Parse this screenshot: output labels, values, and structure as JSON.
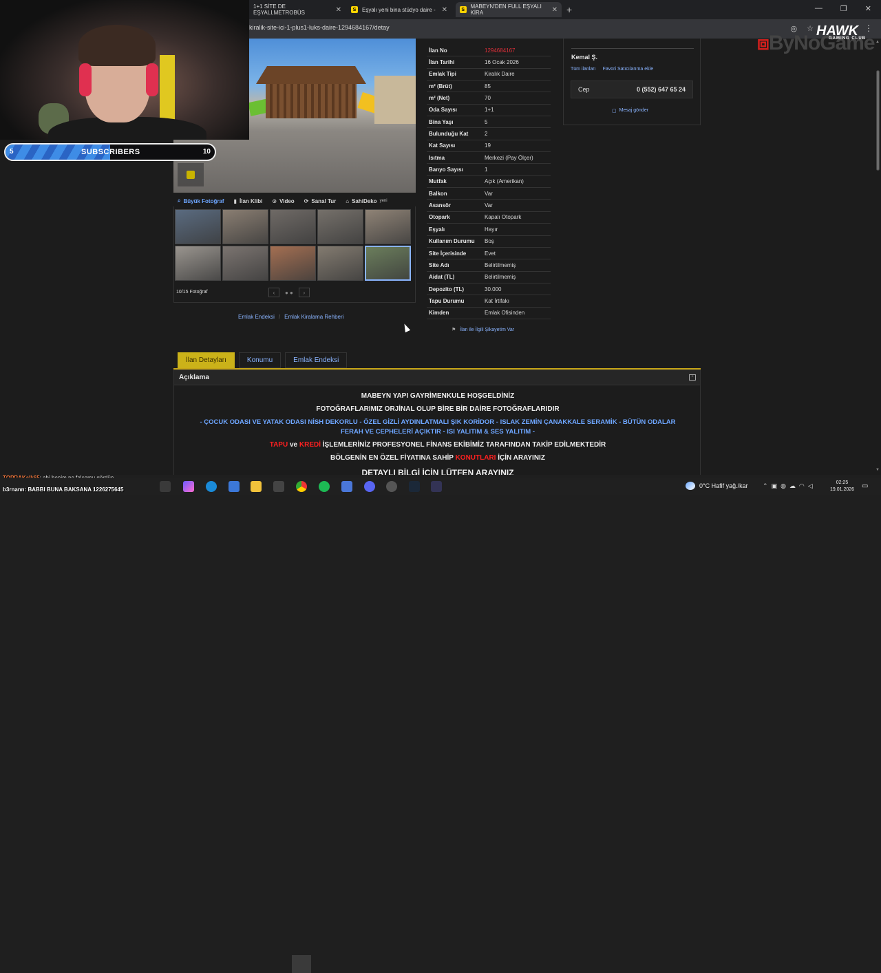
{
  "browser": {
    "tabs": [
      {
        "title": "1+1 SİTE DE EŞYALI,METROBÜS",
        "favicon": "S",
        "active": false
      },
      {
        "title": "Eşyalı yeni bina stüdyo daire - ",
        "favicon": "S",
        "active": false
      },
      {
        "title": "MABEYN'DEN FULL EŞYALI KİRA",
        "favicon": "S",
        "active": true
      }
    ],
    "url": "ali-kiralik-site-ici-1-plus1-luks-daire-1294684167/detay"
  },
  "gallery": {
    "media_tabs": [
      {
        "label": "Büyük Fotoğraf",
        "icon": "magnifier-icon"
      },
      {
        "label": "İlan Klibi",
        "icon": "camera-icon"
      },
      {
        "label": "Video",
        "icon": "play-icon"
      },
      {
        "label": "Sanal Tur",
        "icon": "360-icon"
      },
      {
        "label": "SahiDeko",
        "icon": "home-icon",
        "badge": "yeni"
      }
    ],
    "thumbnail_count_shown": 10,
    "counter": "10/15 Fotoğraf",
    "thumb_colors": [
      "#5a6b80",
      "#8a7e72",
      "#6f6a66",
      "#75706a",
      "#8f8376",
      "#9a958f",
      "#7b7470",
      "#a46f52",
      "#837b70",
      "#6b7e5c"
    ]
  },
  "bottom_links": [
    "Emlak Endeksi",
    "Emlak Kiralama Rehberi"
  ],
  "details": [
    {
      "label": "İlan No",
      "value": "1294684167",
      "highlight": true
    },
    {
      "label": "İlan Tarihi",
      "value": "16 Ocak 2026"
    },
    {
      "label": "Emlak Tipi",
      "value": "Kiralık Daire"
    },
    {
      "label": "m² (Brüt)",
      "value": "85"
    },
    {
      "label": "m² (Net)",
      "value": "70"
    },
    {
      "label": "Oda Sayısı",
      "value": "1+1"
    },
    {
      "label": "Bina Yaşı",
      "value": "5"
    },
    {
      "label": "Bulunduğu Kat",
      "value": "2"
    },
    {
      "label": "Kat Sayısı",
      "value": "19"
    },
    {
      "label": "Isıtma",
      "value": "Merkezi (Pay Ölçer)"
    },
    {
      "label": "Banyo Sayısı",
      "value": "1"
    },
    {
      "label": "Mutfak",
      "value": "Açık (Amerikan)"
    },
    {
      "label": "Balkon",
      "value": "Var"
    },
    {
      "label": "Asansör",
      "value": "Var"
    },
    {
      "label": "Otopark",
      "value": "Kapalı Otopark"
    },
    {
      "label": "Eşyalı",
      "value": "Hayır"
    },
    {
      "label": "Kullanım Durumu",
      "value": "Boş"
    },
    {
      "label": "Site İçerisinde",
      "value": "Evet"
    },
    {
      "label": "Site Adı",
      "value": "Belirtilmemiş"
    },
    {
      "label": "Aidat (TL)",
      "value": "Belirtilmemiş"
    },
    {
      "label": "Depozito (TL)",
      "value": "30.000"
    },
    {
      "label": "Tapu Durumu",
      "value": "Kat İrtifakı"
    },
    {
      "label": "Kimden",
      "value": "Emlak Ofisinden"
    }
  ],
  "report_link": "İlan ile İlgili Şikayetim Var",
  "seller": {
    "name": "Kemal Ş.",
    "links": [
      "Tüm ilanları",
      "Favori Satıcılarıma ekle"
    ],
    "phone_label": "Cep",
    "phone": "0 (552) 647 65 24",
    "message": "Mesaj gönder"
  },
  "content_tabs": [
    "İlan Detayları",
    "Konumu",
    "Emlak Endeksi"
  ],
  "description": {
    "heading": "Açıklama",
    "lines": [
      "MABEYN YAPI GAYRİMENKULE HOŞGELDİNİZ",
      "FOTOĞRAFLARIMIZ ORJİNAL OLUP BİRE BİR DAİRE FOTOĞRAFLARIDIR",
      "- ÇOCUK ODASI VE YATAK ODASI NİSH DEKORLU - ÖZEL GİZLİ AYDINLATMALI ŞIK KORİDOR - ISLAK ZEMİN ÇANAKKALE SERAMİK - BÜTÜN ODALAR",
      "FERAH VE CEPHELERİ AÇIKTIR - ISI YALITIM &  SES YALITIM -",
      "İŞLEMLERİNİZ PROFESYONEL FİNANS EKİBİMİZ TARAFINDAN TAKİP EDİLMEKTEDİR",
      "BÖLGENİN EN ÖZEL FİYATINA SAHİP",
      "İÇİN ARAYINIZ",
      "DETAYLI BİLGİ İÇİN LÜTFEN ARAYINIZ"
    ],
    "red_words": {
      "tapu": "TAPU",
      "ve": "ve",
      "kredi": "KREDİ",
      "konut": "KONUTLARI"
    }
  },
  "overlay": {
    "sub_goal_start": "5",
    "sub_label": "SUBSCRIBERS",
    "sub_goal_end": "10",
    "sub_progress": 0.5,
    "chat": [
      {
        "user": "TOPRAKalk65",
        "message": ": abi benim ne falsomu gördün"
      },
      {
        "user": "b3rnann",
        "message": ": BABBI BUNA BAKSANA 1226275645"
      }
    ],
    "sponsor": "ByNoGame",
    "team_logo": "HAWK",
    "team_sub": "GAMING CLUB"
  },
  "taskbar": {
    "weather": "0°C  Hafif yağ./kar",
    "time": "02:25",
    "date": "19.01.2026"
  }
}
